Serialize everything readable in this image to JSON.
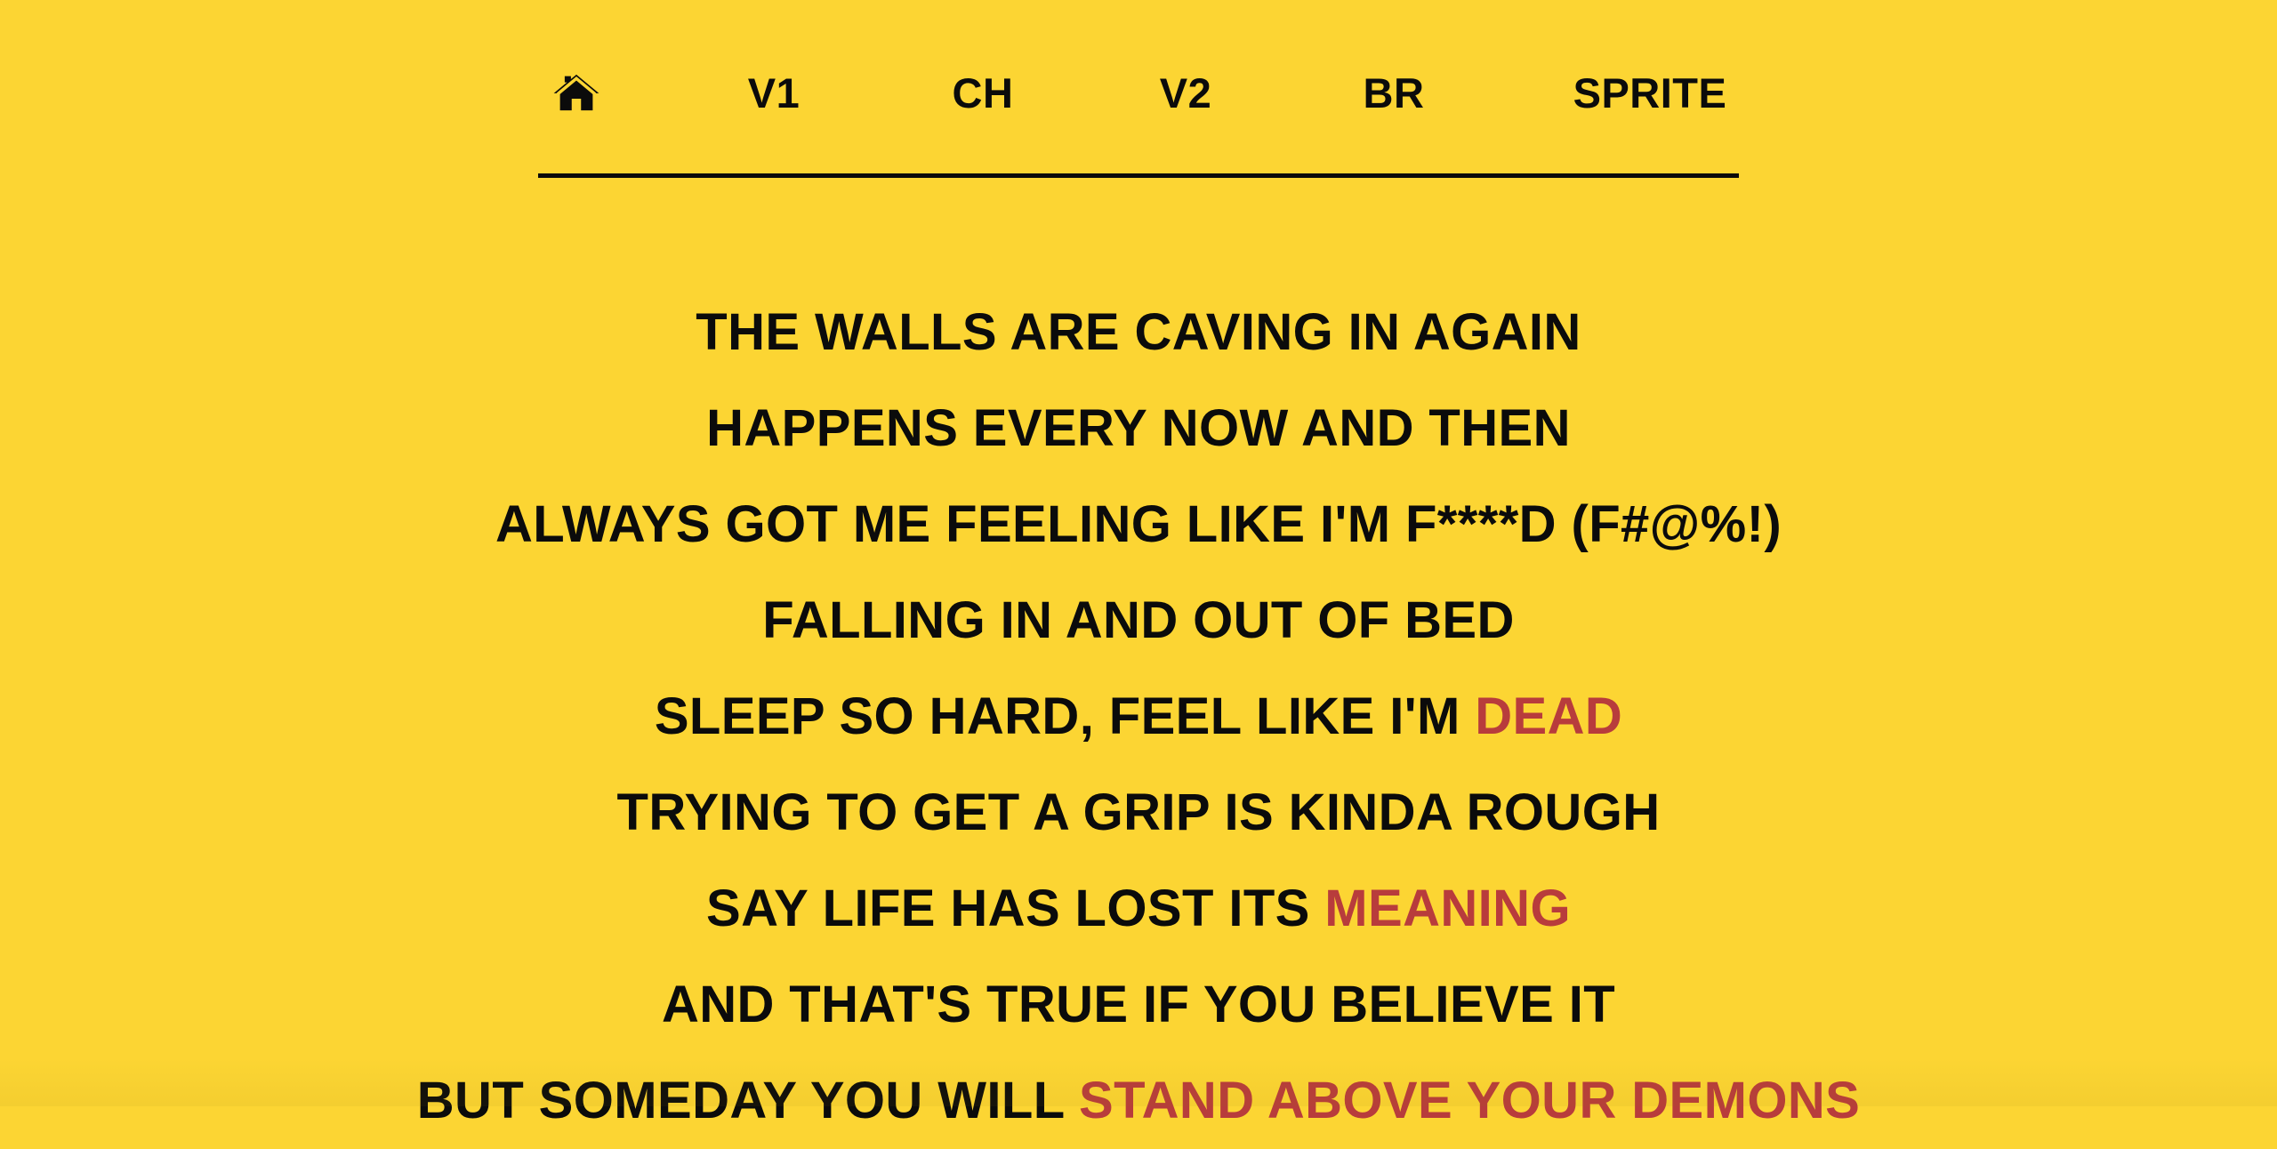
{
  "nav": {
    "home_icon": "home-icon",
    "items": [
      {
        "label": "V1"
      },
      {
        "label": "CH"
      },
      {
        "label": "V2"
      },
      {
        "label": "BR"
      },
      {
        "label": "SPRITE"
      }
    ]
  },
  "lyrics": {
    "lines": [
      {
        "text": "THE WALLS ARE CAVING IN AGAIN"
      },
      {
        "text": "HAPPENS EVERY NOW AND THEN"
      },
      {
        "text": "ALWAYS GOT ME FEELING LIKE I'M F****D (F#@%!)"
      },
      {
        "text": "FALLING IN AND OUT OF BED"
      },
      {
        "text": "SLEEP SO HARD, FEEL LIKE I'M ",
        "highlight": "DEAD"
      },
      {
        "text": "TRYING TO GET A GRIP IS KINDA ROUGH"
      },
      {
        "text": "SAY LIFE HAS LOST ITS ",
        "highlight": "MEANING"
      },
      {
        "text": "AND THAT'S TRUE IF YOU BELIEVE IT"
      },
      {
        "text": "BUT SOMEDAY YOU WILL ",
        "highlight": "STAND ABOVE YOUR DEMONS"
      }
    ]
  },
  "colors": {
    "background": "#fcd533",
    "text": "#0b0b0b",
    "highlight": "#b83c3c",
    "rule": "#0a0a0a"
  }
}
